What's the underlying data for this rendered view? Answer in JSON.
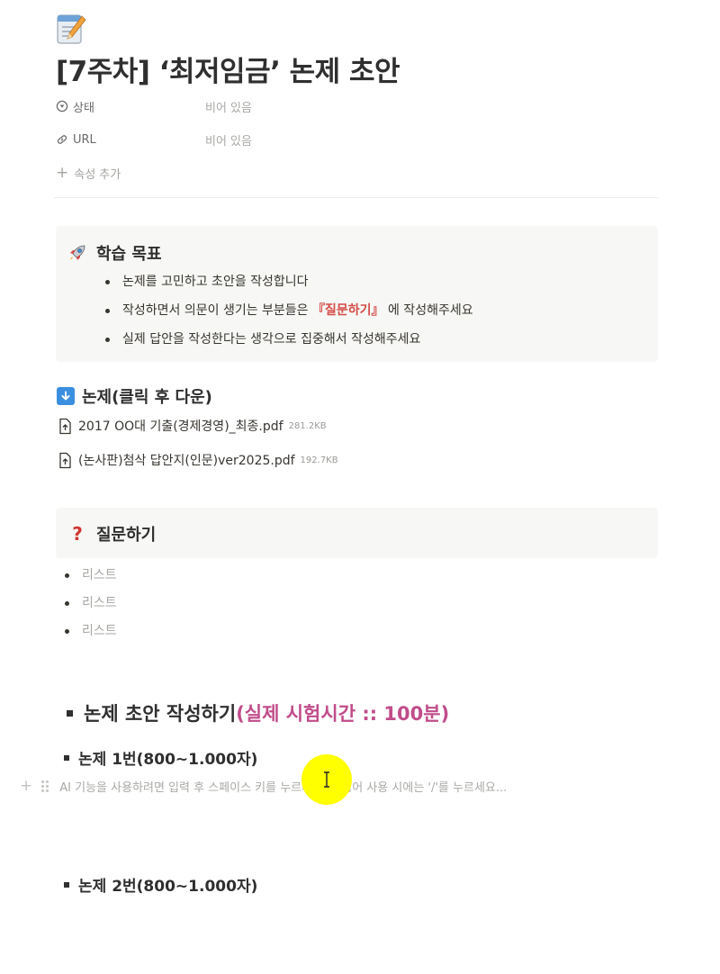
{
  "page": {
    "icon": "memo-icon",
    "title": "[7주차] ‘최저임금’ 논제 초안"
  },
  "properties": [
    {
      "name": "상태",
      "icon": "status-icon",
      "value": "비어 있음"
    },
    {
      "name": "URL",
      "icon": "link-icon",
      "value": "비어 있음"
    }
  ],
  "add_property_label": "속성 추가",
  "goals": {
    "icon": "rocket-icon",
    "title": "학습 목표",
    "items": [
      {
        "text": "논제를 고민하고 초안을 작성합니다"
      },
      {
        "pre": "작성하면서 의문이 생기는 부분들은 ",
        "highlight": "『질문하기』",
        "post": " 에 작성해주세요"
      },
      {
        "text": "실제 답안을 작성한다는 생각으로 집중해서 작성해주세요"
      }
    ]
  },
  "topic": {
    "icon": "down-arrow-icon",
    "title": "논제(클릭 후 다운)",
    "files": [
      {
        "name": "2017 OO대 기출(경제경영)_최종.pdf",
        "size": "281.2KB"
      },
      {
        "name": "(논사판)첨삭 답안지(인문)ver2025.pdf",
        "size": "192.7KB"
      }
    ]
  },
  "questions": {
    "icon": "question-mark-icon",
    "title": "질문하기",
    "items": [
      "리스트",
      "리스트",
      "리스트"
    ]
  },
  "draft": {
    "title": "논제 초안 작성하기",
    "highlight": "(실제 시험시간 :: 100분)",
    "topic1": "논제 1번(800~1.000자)",
    "topic2": "논제 2번(800~1.000자)",
    "placeholder": "AI 기능을 사용하려면 입력 후 스페이스 키를 누르세요. 명령어 사용 시에는 '/'를 누르세요..."
  },
  "colors": {
    "accent_red": "#d44c47",
    "accent_pink": "#c14c8a",
    "cursor_highlight": "#ffff00"
  }
}
